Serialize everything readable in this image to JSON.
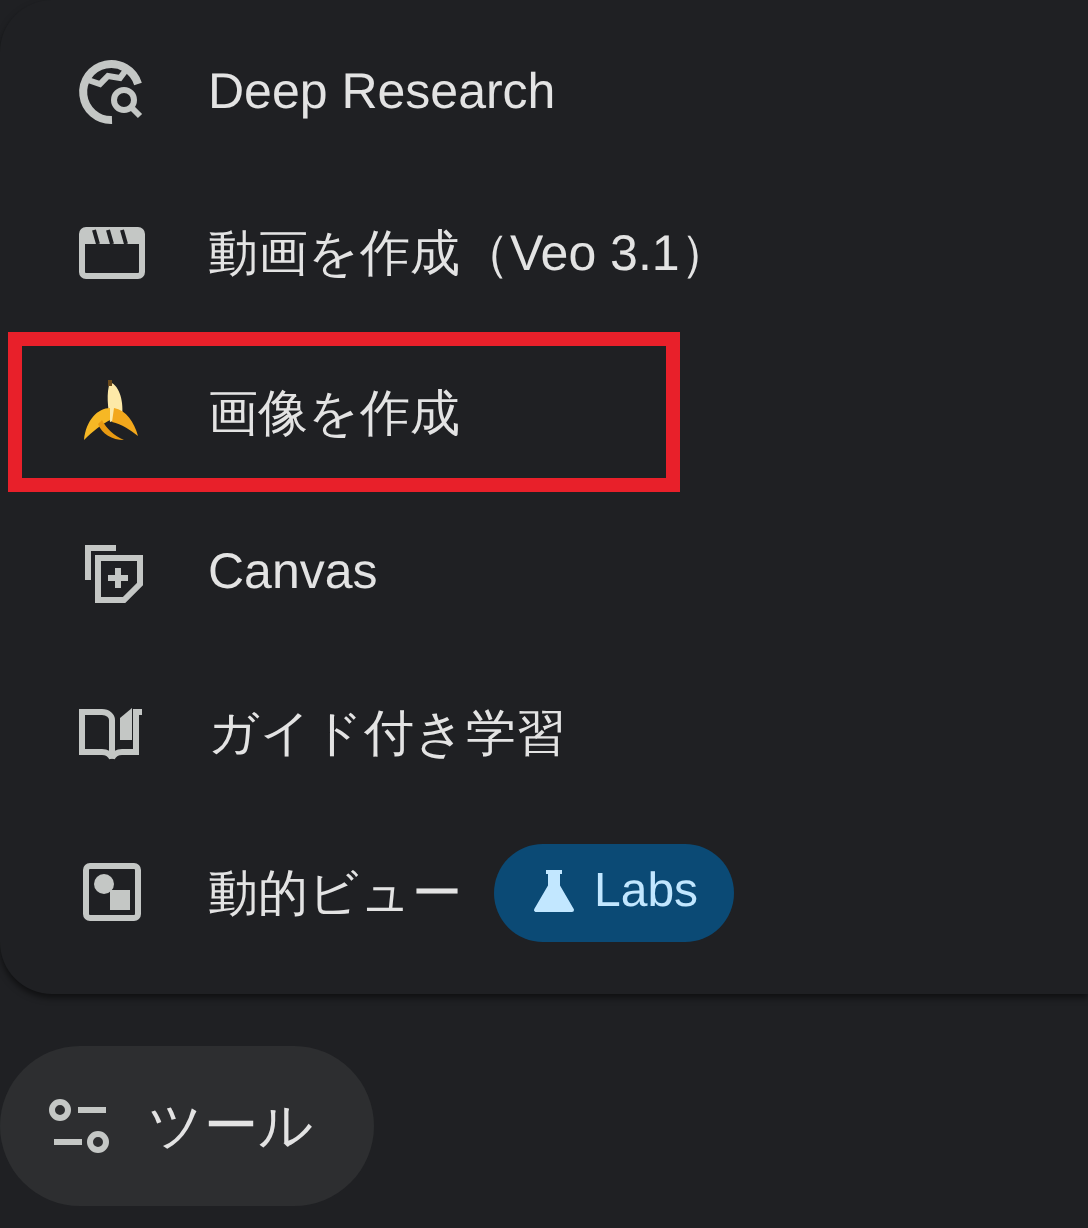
{
  "menu": {
    "items": [
      {
        "kind": "research",
        "label": "Deep Research",
        "highlighted": false
      },
      {
        "kind": "video",
        "label": "動画を作成（Veo 3.1）",
        "highlighted": false
      },
      {
        "kind": "banana",
        "label": "画像を作成",
        "highlighted": true
      },
      {
        "kind": "canvas",
        "label": "Canvas",
        "highlighted": false
      },
      {
        "kind": "book",
        "label": "ガイド付き学習",
        "highlighted": false
      },
      {
        "kind": "view",
        "label": "動的ビュー",
        "highlighted": false,
        "badge": "Labs"
      }
    ]
  },
  "tools_button": {
    "label": "ツール"
  }
}
